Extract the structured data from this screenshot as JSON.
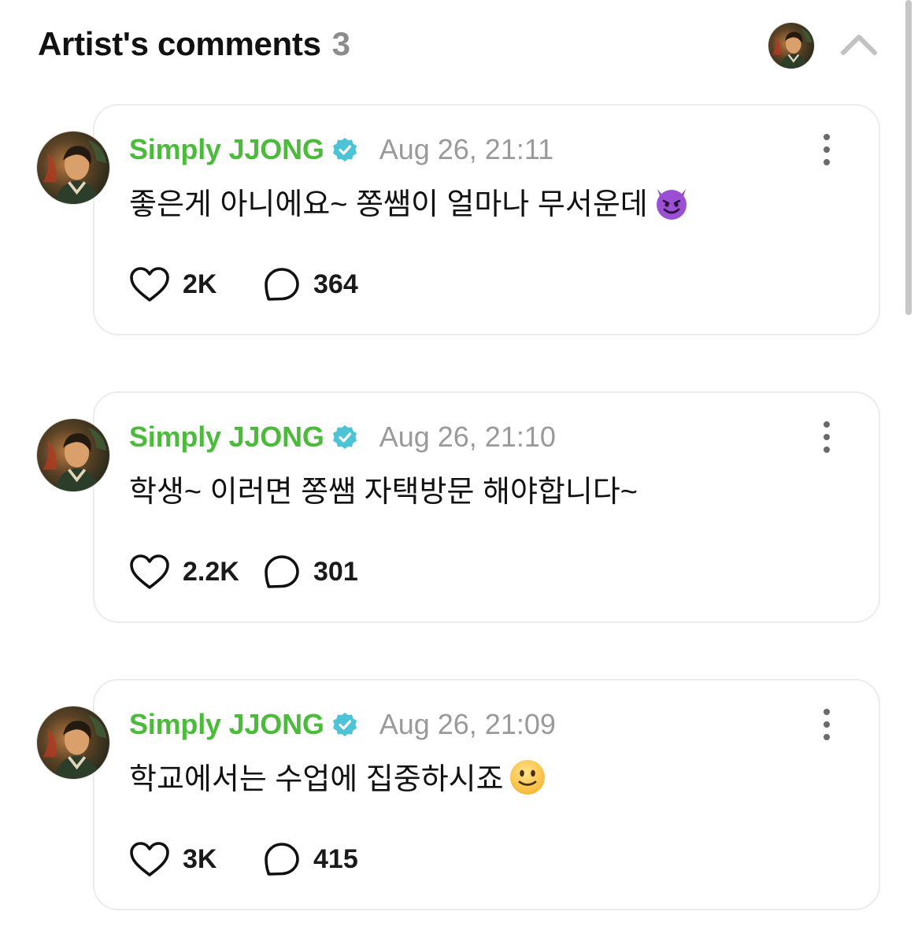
{
  "header": {
    "title": "Artist's comments",
    "count": "3"
  },
  "icons": {
    "verified": "verified-badge-icon",
    "like": "heart-icon",
    "reply": "speech-bubble-icon",
    "more": "vertical-ellipsis-icon",
    "collapse": "chevron-up-icon"
  },
  "colors": {
    "author": "#4cbb3c",
    "verified": "#4cc3d6",
    "timestamp": "#9a9a9a",
    "count": "#8c8c8c"
  },
  "comments": [
    {
      "author": "Simply JJONG",
      "timestamp": "Aug 26, 21:11",
      "text": "좋은게 아니에요~ 쫑쌤이 얼마나 무서운데",
      "emoji": "smiling-devil-emoji",
      "likes": "2K",
      "replies": "364"
    },
    {
      "author": "Simply JJONG",
      "timestamp": "Aug 26, 21:10",
      "text": "학생~ 이러면 쫑쌤 자택방문 해야합니다~",
      "emoji": "",
      "likes": "2.2K",
      "replies": "301"
    },
    {
      "author": "Simply JJONG",
      "timestamp": "Aug 26, 21:09",
      "text": "학교에서는 수업에 집중하시죠",
      "emoji": "slightly-smiling-face-emoji",
      "likes": "3K",
      "replies": "415"
    }
  ]
}
